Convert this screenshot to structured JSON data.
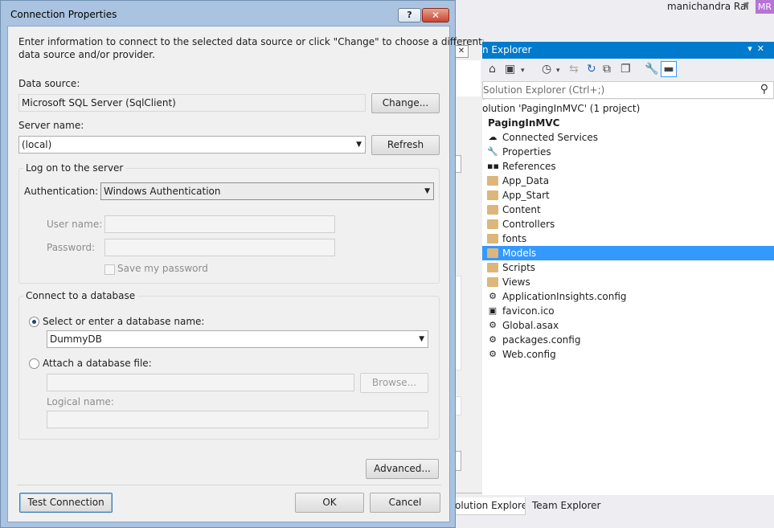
{
  "ide": {
    "user_name": "manichandra Rai",
    "user_initials": "MR",
    "user_badge_color": "#b674d6"
  },
  "solution_explorer": {
    "title": "n Explorer",
    "search_placeholder": "Solution Explorer (Ctrl+;)",
    "tree": [
      {
        "label": "olution 'PagingInMVC' (1 project)",
        "icon": "solution-icon",
        "bold": false
      },
      {
        "label": "PagingInMVC",
        "icon": "project-icon",
        "bold": true
      },
      {
        "label": "Connected Services",
        "icon": "connected-services-icon"
      },
      {
        "label": "Properties",
        "icon": "wrench-icon"
      },
      {
        "label": "References",
        "icon": "references-icon"
      },
      {
        "label": "App_Data",
        "icon": "folder-icon"
      },
      {
        "label": "App_Start",
        "icon": "folder-icon"
      },
      {
        "label": "Content",
        "icon": "folder-icon"
      },
      {
        "label": "Controllers",
        "icon": "folder-icon"
      },
      {
        "label": "fonts",
        "icon": "folder-icon"
      },
      {
        "label": "Models",
        "icon": "folder-icon",
        "selected": true
      },
      {
        "label": "Scripts",
        "icon": "folder-icon"
      },
      {
        "label": "Views",
        "icon": "folder-icon"
      },
      {
        "label": "ApplicationInsights.config",
        "icon": "config-file-icon"
      },
      {
        "label": "favicon.ico",
        "icon": "image-file-icon"
      },
      {
        "label": "Global.asax",
        "icon": "asax-file-icon"
      },
      {
        "label": "packages.config",
        "icon": "config-file-icon"
      },
      {
        "label": "Web.config",
        "icon": "config-file-icon"
      }
    ],
    "tabs": {
      "solution_explorer": "olution Explorer",
      "team_explorer": "Team Explorer"
    },
    "accent_color": "#007acc",
    "selection_color": "#3399ff"
  },
  "dialog": {
    "title": "Connection Properties",
    "help_label": "?",
    "close_label": "✕",
    "intro": "Enter information to connect to the selected data source or click \"Change\" to choose a different",
    "intro_line2": "data source and/or provider.",
    "data_source_label": "Data source:",
    "data_source_value": "Microsoft SQL Server (SqlClient)",
    "change_label": "Change...",
    "server_name_label": "Server name:",
    "server_name_value": "(local)",
    "refresh_label": "Refresh",
    "logon_group": "Log on to the server",
    "auth_label": "Authentication:",
    "auth_value": "Windows Authentication",
    "username_label": "User name:",
    "password_label": "Password:",
    "save_password_label": "Save my password",
    "save_password_checked": false,
    "connect_group": "Connect to a database",
    "select_db_label": "Select or enter a database name:",
    "select_db_selected": true,
    "database_value": "DummyDB",
    "attach_label": "Attach a database file:",
    "browse_label": "Browse...",
    "logical_name_label": "Logical name:",
    "advanced_label": "Advanced...",
    "test_connection_label": "Test Connection",
    "ok_label": "OK",
    "cancel_label": "Cancel"
  }
}
